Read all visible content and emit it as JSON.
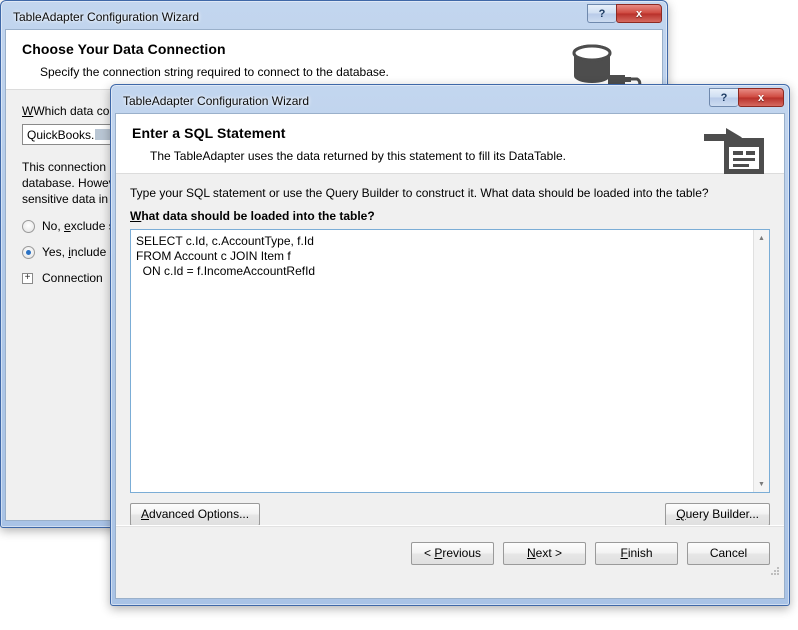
{
  "background_window": {
    "title": "TableAdapter Configuration Wizard",
    "caption_buttons": {
      "help": "?",
      "close": "x"
    },
    "header": {
      "title": "Choose Your Data Connection",
      "subtitle": "Specify the connection string required to connect to the database.",
      "icon": "database-connection-icon"
    },
    "connection_label": "Which data connection should your application use to connect to the database?",
    "connection_label_short": "Which data conn",
    "connection_value": "QuickBooks.",
    "description": "This connection string appears to contain sensitive data that is required to connect to the database. However, storing sensitive data in the connection string can be a security risk. Do you want to include this sensitive data in the connection string?",
    "description_lines": [
      "This connection ",
      "database. Howev",
      "sensitive data in"
    ],
    "radio_exclude": "No, exclude sensitive data from the connection string. I will set this information in my application code.",
    "radio_exclude_short": "No, exclude s",
    "radio_include": "Yes, include sensitive data in the connection string.",
    "radio_include_short": "Yes, include s",
    "radio_selected": "include",
    "expander_label": "Connection string",
    "expander_label_short": "Connection ",
    "expander_glyph": "+"
  },
  "foreground_dialog": {
    "title": "TableAdapter Configuration Wizard",
    "caption_buttons": {
      "help": "?",
      "close": "x"
    },
    "header": {
      "title": "Enter a SQL Statement",
      "subtitle": "The TableAdapter uses the data returned by this statement to fill its DataTable.",
      "icon": "sql-statement-icon"
    },
    "intro_text": "Type your SQL statement or use the Query Builder to construct it. What data should be loaded into the table?",
    "query_label": "What data should be loaded into the table?",
    "sql_statement": "SELECT c.Id, c.AccountType, f.Id\nFROM Account c JOIN Item f\n  ON c.Id = f.IncomeAccountRefId",
    "scrollbar": {
      "up_glyph": "▲",
      "down_glyph": "▼"
    },
    "buttons": {
      "advanced_options": "Advanced Options...",
      "query_builder": "Query Builder...",
      "previous": "< Previous",
      "next": "Next >",
      "finish": "Finish",
      "cancel": "Cancel"
    }
  },
  "colors": {
    "title_bar_blue": "#b2cae9",
    "window_border": "#3f68a8",
    "client_bg": "#f0f0f0",
    "close_red": "#cf4a40",
    "radio_dot": "#2a72c4",
    "textarea_border": "#7badd6"
  }
}
